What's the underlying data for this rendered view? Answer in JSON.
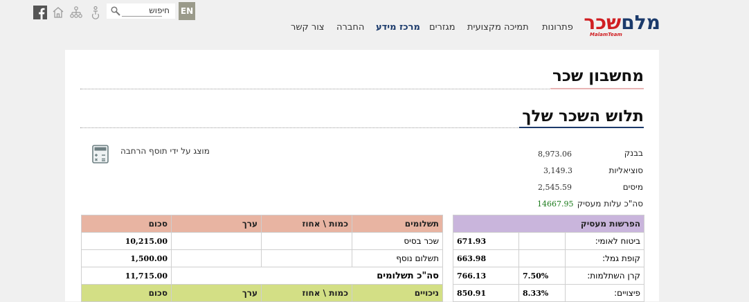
{
  "header": {
    "logo_main_dark": "מלם",
    "logo_main_red": "שכר",
    "logo_sub": "MalamTeam",
    "nav": [
      "פתרונות",
      "תמיכה מקצועית",
      "מגזרים",
      "מרכז מידע",
      "החברה",
      "צור קשר"
    ],
    "nav_active_index": 3,
    "lang_button": "EN",
    "search_value": "חיפוש",
    "icons": [
      "facebook-icon",
      "home-icon",
      "sitemap-icon",
      "accessibility-icon",
      "search-icon"
    ]
  },
  "page": {
    "title": "מחשבון שכר",
    "section_title": "תלוש השכר שלך",
    "calc_note": "מוצג על ידי תוסף הרחבה"
  },
  "summary": [
    {
      "label": "בבנק",
      "value": "8,973.06"
    },
    {
      "label": "סוציאליות",
      "value": "3,149.3"
    },
    {
      "label": "מיסים",
      "value": "2,545.59"
    },
    {
      "label": "סה\"כ עלות מעסיק",
      "value": "14667.95"
    }
  ],
  "employer_table": {
    "header": "הפרשות מעסיק",
    "rows": [
      {
        "label": "ביטוח לאומי:",
        "pct": "",
        "value": "671.93"
      },
      {
        "label": "קופת גמל:",
        "pct": "",
        "value": "663.98"
      },
      {
        "label": "קרן השתלמות:",
        "pct": "7.50%",
        "value": "766.13"
      },
      {
        "label": "פיצויים:",
        "pct": "8.33%",
        "value": "850.91"
      }
    ]
  },
  "payments_table": {
    "headers": [
      "תשלומים",
      "כמות \\ אחוז",
      "ערך",
      "סכום"
    ],
    "rows": [
      {
        "name": "שכר בסיס",
        "qty": "",
        "value": "",
        "sum": "10,215.00"
      },
      {
        "name": "תשלום נוסף",
        "qty": "",
        "value": "",
        "sum": "1,500.00"
      }
    ],
    "total_label": "סה\"כ תשלומים",
    "total_sum": "11,715.00"
  },
  "deductions_table": {
    "headers": [
      "ניכויים",
      "כמות \\ אחוז",
      "ערך",
      "סכום"
    ]
  },
  "colors": {
    "brand_dark": "#1b3a6b",
    "brand_red": "#d01e22",
    "employer_header": "#c9b5dc",
    "payments_header": "#e8b4a2",
    "deductions_header": "#d3df85",
    "total_green": "#1a7a1a"
  }
}
